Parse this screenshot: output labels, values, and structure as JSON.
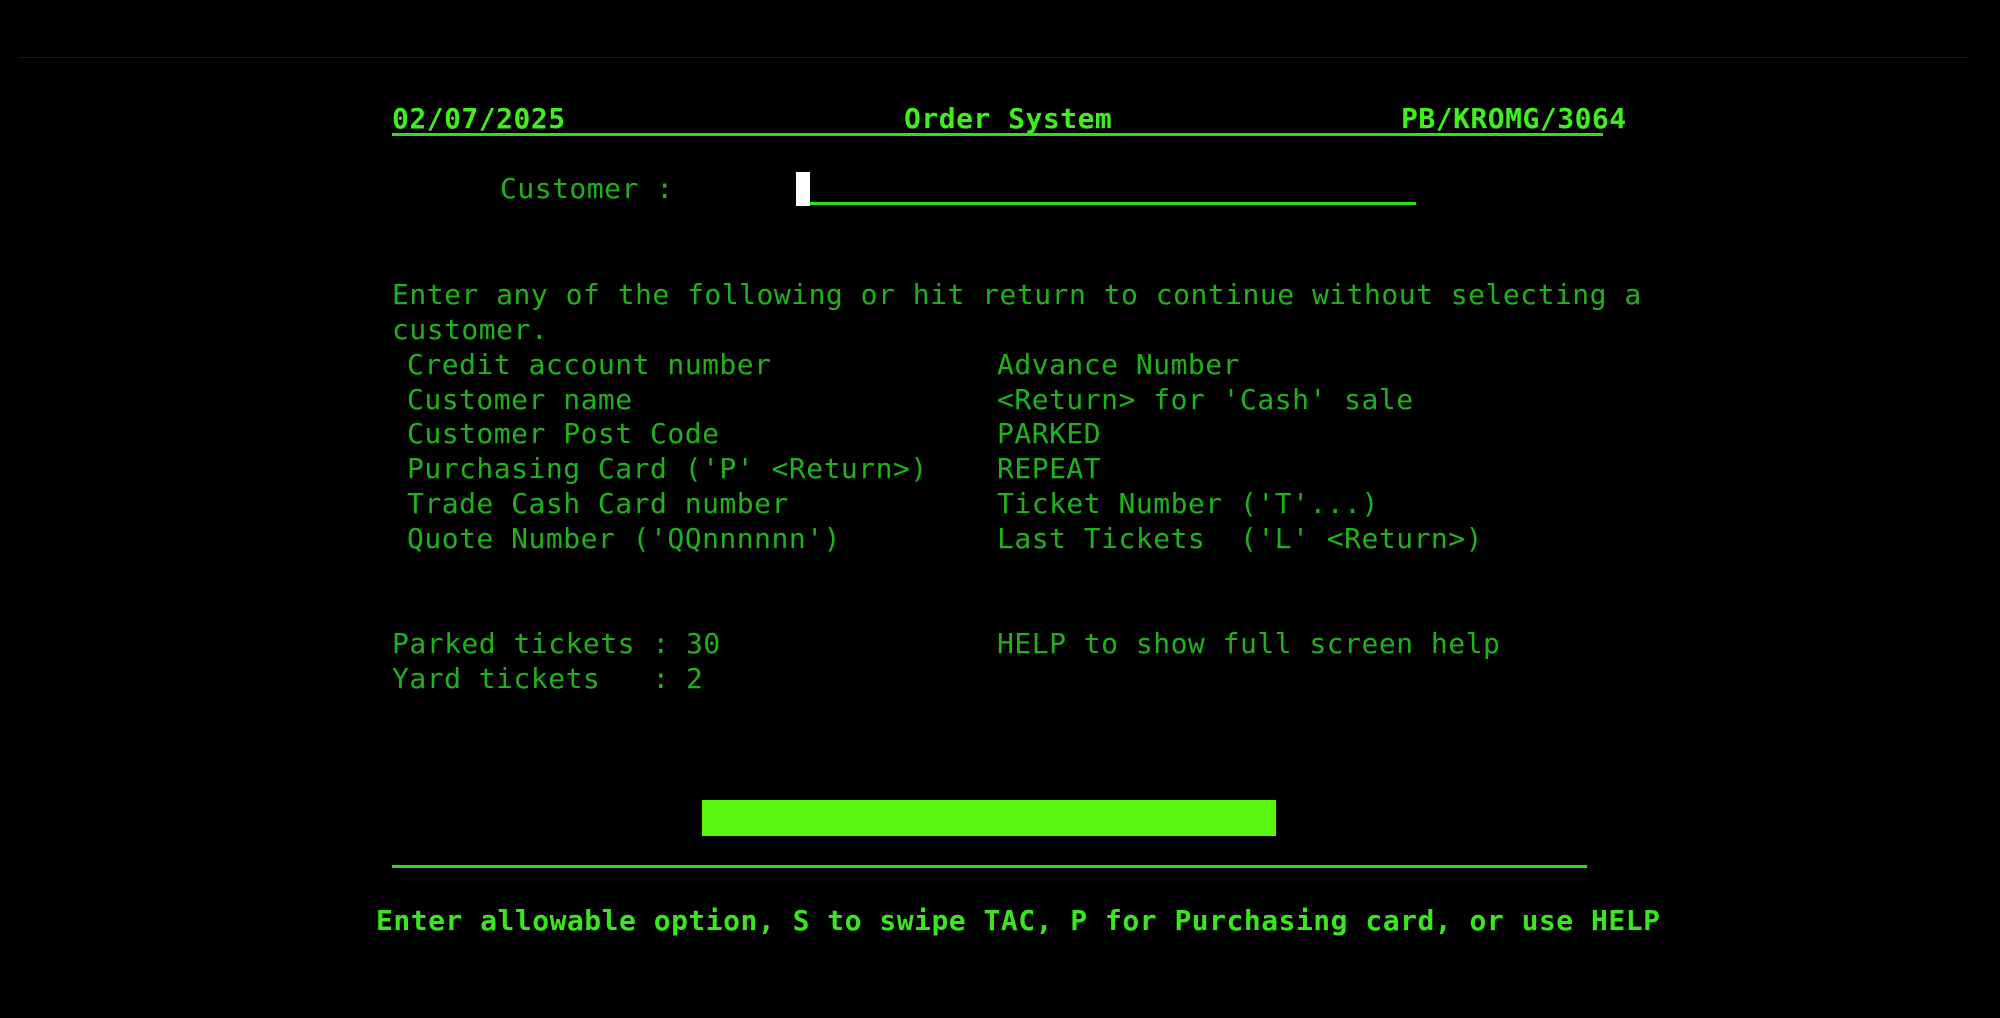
{
  "header": {
    "date": "02/07/2025",
    "title": "Order System",
    "terminal_id": "PB/KROMG/3064"
  },
  "customer_field": {
    "label": "Customer :",
    "value": ""
  },
  "instructions": {
    "line1": "Enter any of the following or hit return to continue without selecting a",
    "line2": "customer."
  },
  "options_left": [
    "Credit account number",
    "Customer name",
    "Customer Post Code",
    "Purchasing Card ('P' <Return>)",
    "Trade Cash Card number",
    "Quote Number ('QQnnnnnn')"
  ],
  "options_right": [
    "Advance Number",
    "<Return> for 'Cash' sale",
    "PARKED",
    "REPEAT",
    "Ticket Number ('T'...)",
    "Last Tickets  ('L' <Return>)"
  ],
  "stats": {
    "parked_label": "Parked tickets :",
    "parked_value": "30",
    "yard_label": "Yard tickets   :",
    "yard_value": "2",
    "help_text": "HELP to show full screen help"
  },
  "status_line": "Enter allowable option, S to swipe TAC, P for Purchasing card, or use HELP",
  "colors": {
    "background": "#000000",
    "text_green": "#1fd11a",
    "bright_green": "#5af70e",
    "cursor": "#ffffff"
  }
}
